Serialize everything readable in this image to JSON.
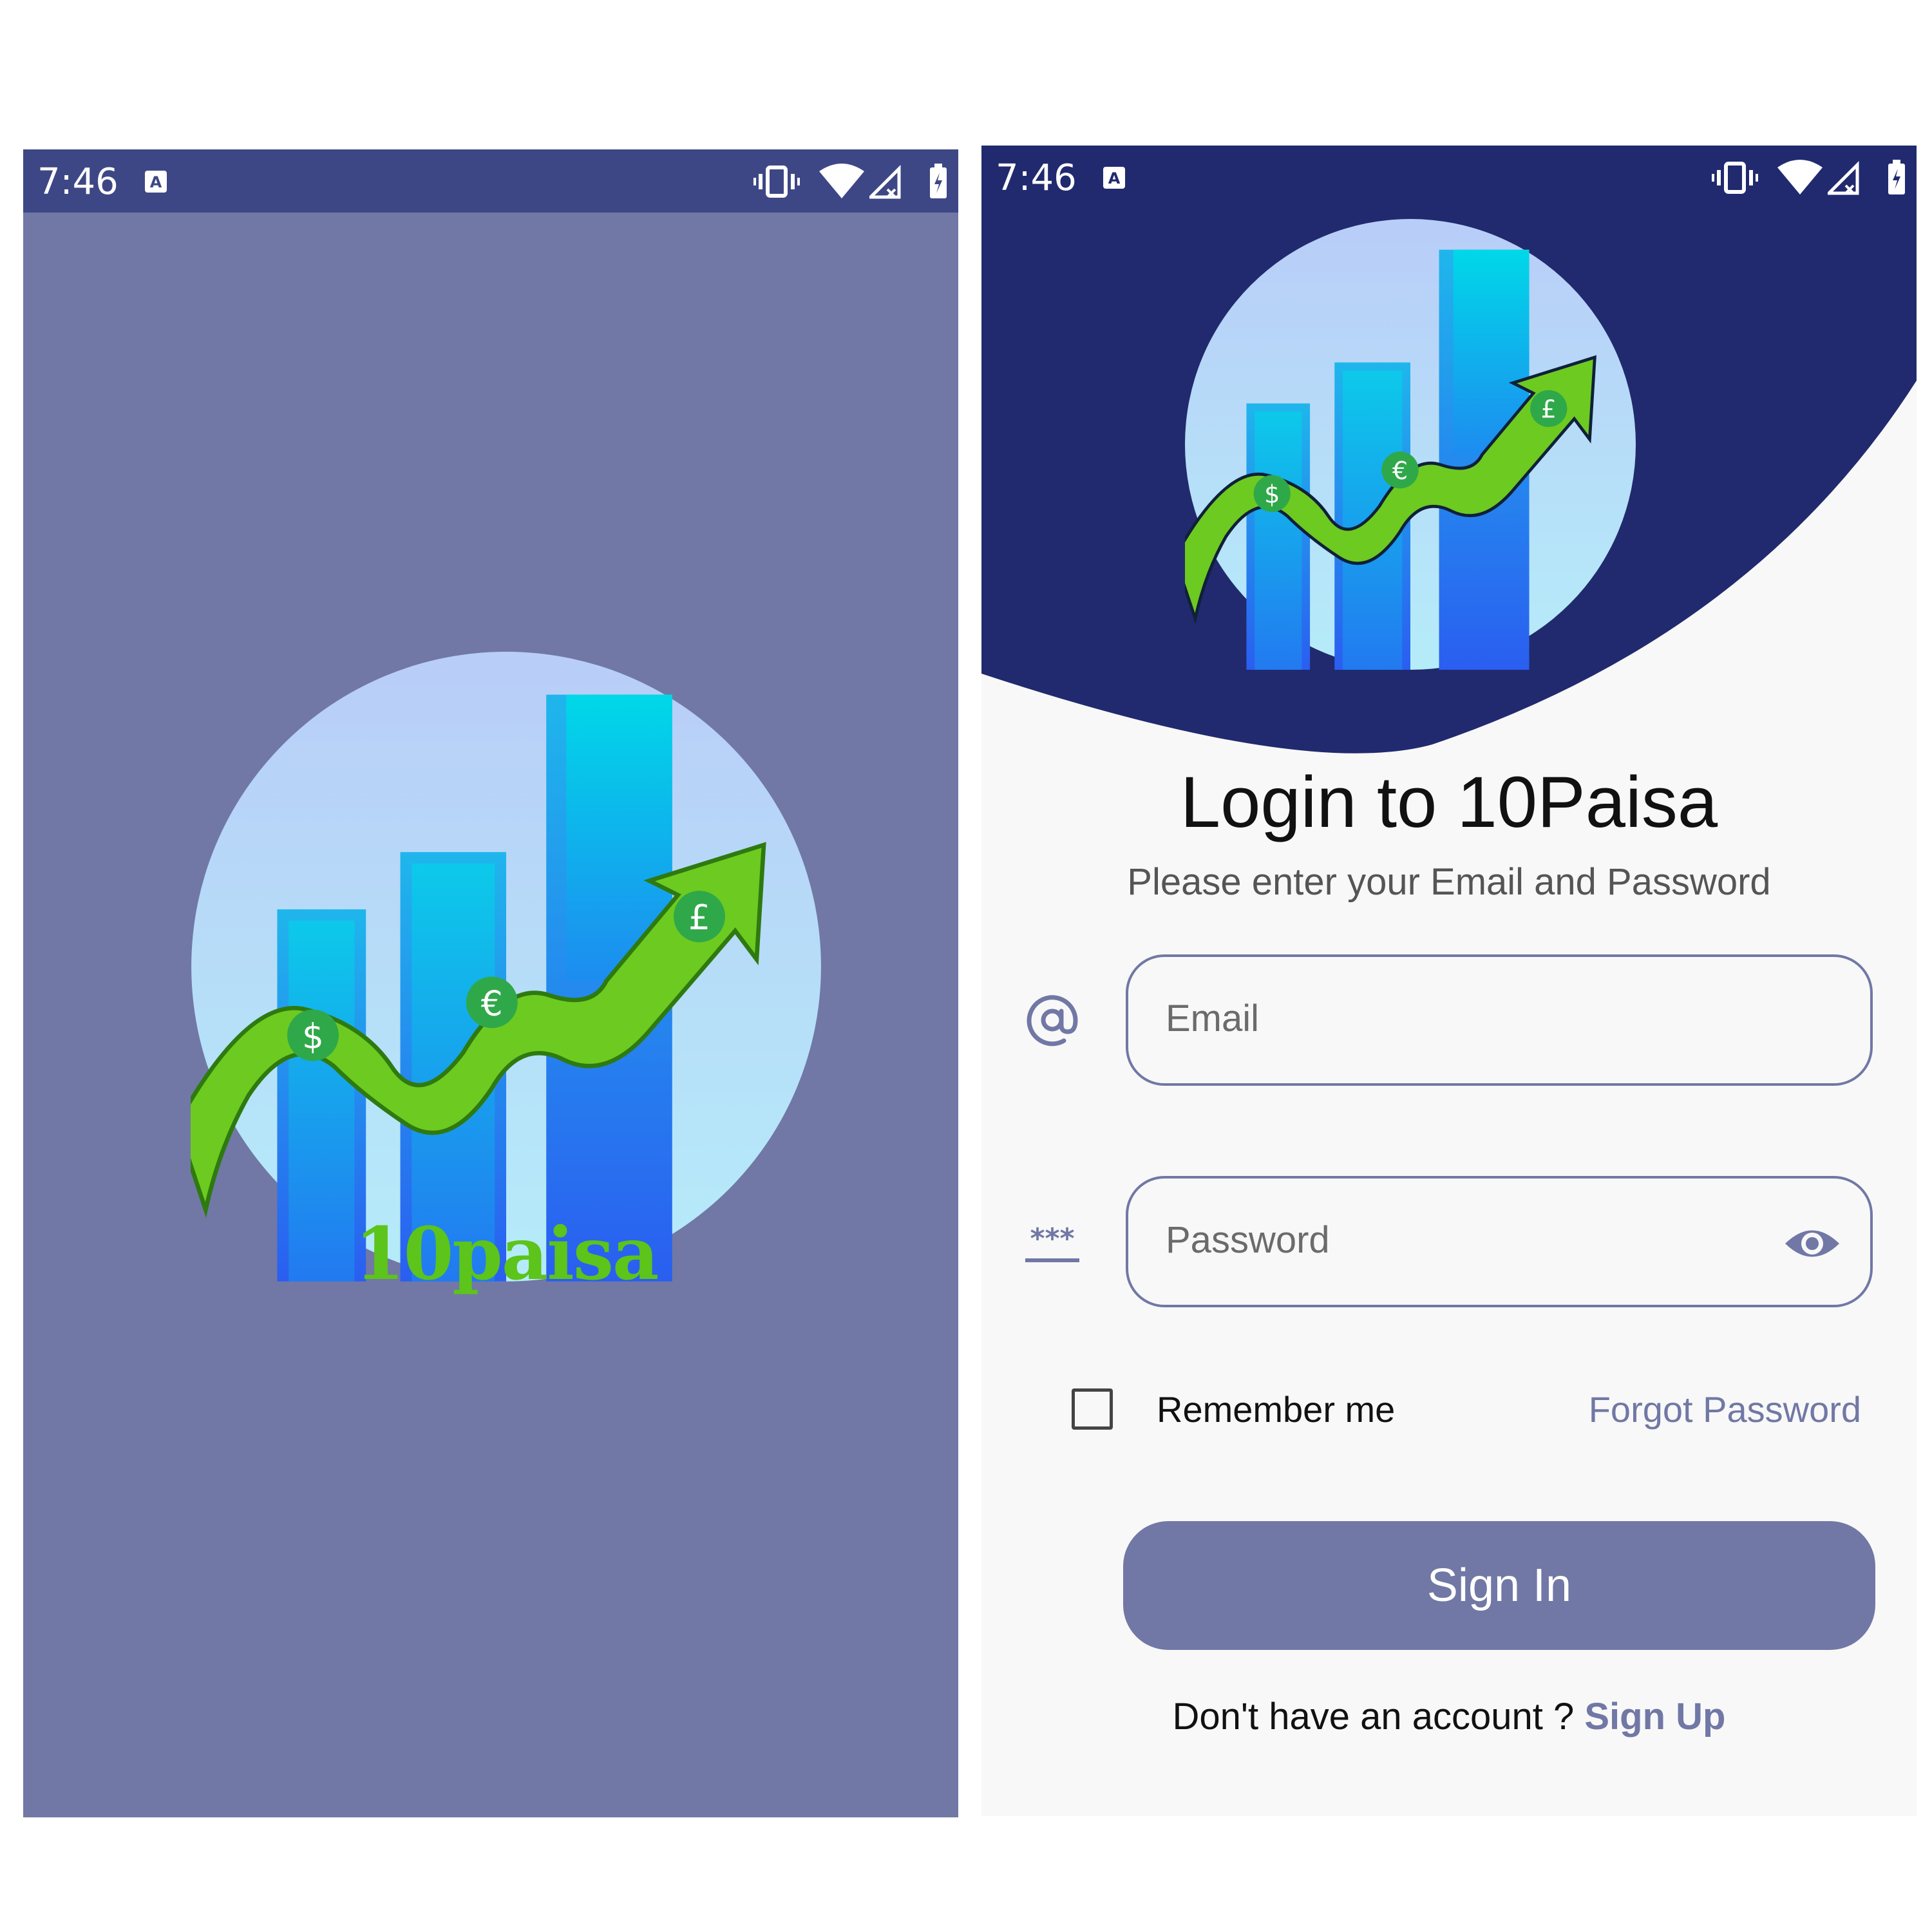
{
  "colors": {
    "splash_bg": "#7178a5",
    "splash_statusbar": "#3e4785",
    "login_header": "#212a6e",
    "accent": "#7178a5",
    "brand_green": "#5cc41a"
  },
  "splash": {
    "status_time": "7:46",
    "brand_name": "10paisa",
    "logo_icon": "growth-chart-money-icon"
  },
  "login": {
    "status_time": "7:46",
    "title": "Login to 10Paisa",
    "subtitle": "Please enter your Email and Password",
    "email": {
      "icon": "at-sign-icon",
      "placeholder": "Email",
      "value": ""
    },
    "password": {
      "icon": "password-icon",
      "placeholder": "Password",
      "value": "",
      "toggle_icon": "eye-icon"
    },
    "remember_label": "Remember me",
    "remember_checked": false,
    "forgot_label": "Forgot Password",
    "signin_label": "Sign In",
    "signup_prompt": "Don't have an account ? ",
    "signup_link": "Sign Up"
  }
}
